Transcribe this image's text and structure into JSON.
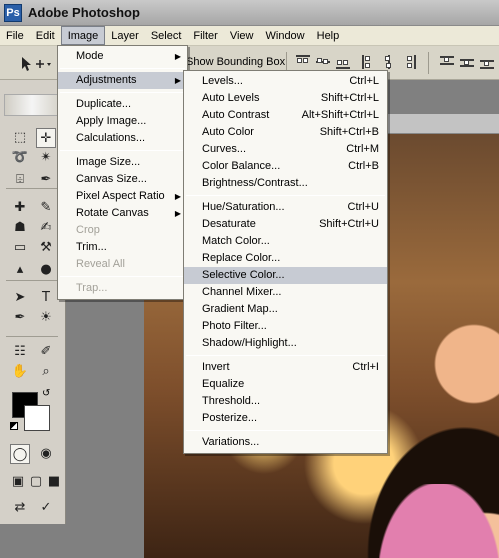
{
  "window": {
    "title": "Adobe Photoshop",
    "icon_letter": "Ps"
  },
  "menubar": [
    "File",
    "Edit",
    "Image",
    "Layer",
    "Select",
    "Filter",
    "View",
    "Window",
    "Help"
  ],
  "options": {
    "bounding_box_label": "Show Bounding Box"
  },
  "image_menu": [
    {
      "label": "Mode",
      "submenu": true
    },
    {
      "sep": true
    },
    {
      "label": "Adjustments",
      "submenu": true,
      "selected": true
    },
    {
      "sep": true
    },
    {
      "label": "Duplicate..."
    },
    {
      "label": "Apply Image..."
    },
    {
      "label": "Calculations..."
    },
    {
      "sep": true
    },
    {
      "label": "Image Size..."
    },
    {
      "label": "Canvas Size..."
    },
    {
      "label": "Pixel Aspect Ratio",
      "submenu": true
    },
    {
      "label": "Rotate Canvas",
      "submenu": true
    },
    {
      "label": "Crop",
      "disabled": true
    },
    {
      "label": "Trim..."
    },
    {
      "label": "Reveal All",
      "disabled": true
    },
    {
      "sep": true
    },
    {
      "label": "Trap...",
      "disabled": true
    }
  ],
  "adjustments_menu": [
    {
      "label": "Levels...",
      "shortcut": "Ctrl+L"
    },
    {
      "label": "Auto Levels",
      "shortcut": "Shift+Ctrl+L"
    },
    {
      "label": "Auto Contrast",
      "shortcut": "Alt+Shift+Ctrl+L"
    },
    {
      "label": "Auto Color",
      "shortcut": "Shift+Ctrl+B"
    },
    {
      "label": "Curves...",
      "shortcut": "Ctrl+M"
    },
    {
      "label": "Color Balance...",
      "shortcut": "Ctrl+B"
    },
    {
      "label": "Brightness/Contrast..."
    },
    {
      "sep": true
    },
    {
      "label": "Hue/Saturation...",
      "shortcut": "Ctrl+U"
    },
    {
      "label": "Desaturate",
      "shortcut": "Shift+Ctrl+U"
    },
    {
      "label": "Match Color..."
    },
    {
      "label": "Replace Color..."
    },
    {
      "label": "Selective Color...",
      "selected": true
    },
    {
      "label": "Channel Mixer..."
    },
    {
      "label": "Gradient Map..."
    },
    {
      "label": "Photo Filter..."
    },
    {
      "label": "Shadow/Highlight..."
    },
    {
      "sep": true
    },
    {
      "label": "Invert",
      "shortcut": "Ctrl+I"
    },
    {
      "label": "Equalize"
    },
    {
      "label": "Threshold..."
    },
    {
      "label": "Posterize..."
    },
    {
      "sep": true
    },
    {
      "label": "Variations..."
    }
  ],
  "toolbox": {
    "foreground_color": "#000000",
    "background_color": "#ffffff",
    "tools": [
      "marquee-tool-icon",
      "move-tool-icon",
      "lasso-tool-icon",
      "magic-wand-tool-icon",
      "crop-tool-icon",
      "slice-tool-icon",
      "healing-brush-tool-icon",
      "brush-tool-icon",
      "clone-stamp-tool-icon",
      "history-brush-tool-icon",
      "eraser-tool-icon",
      "paint-bucket-tool-icon",
      "blur-tool-icon",
      "dodge-tool-icon",
      "path-selection-tool-icon",
      "type-tool-icon",
      "pen-tool-icon",
      "custom-shape-tool-icon",
      "notes-tool-icon",
      "eyedropper-tool-icon",
      "hand-tool-icon",
      "zoom-tool-icon"
    ]
  },
  "colors": {
    "menu_highlight": "#c7cbd3",
    "menu_bg": "#f9f8f3",
    "toolbox_bg": "#d4d0c8"
  }
}
